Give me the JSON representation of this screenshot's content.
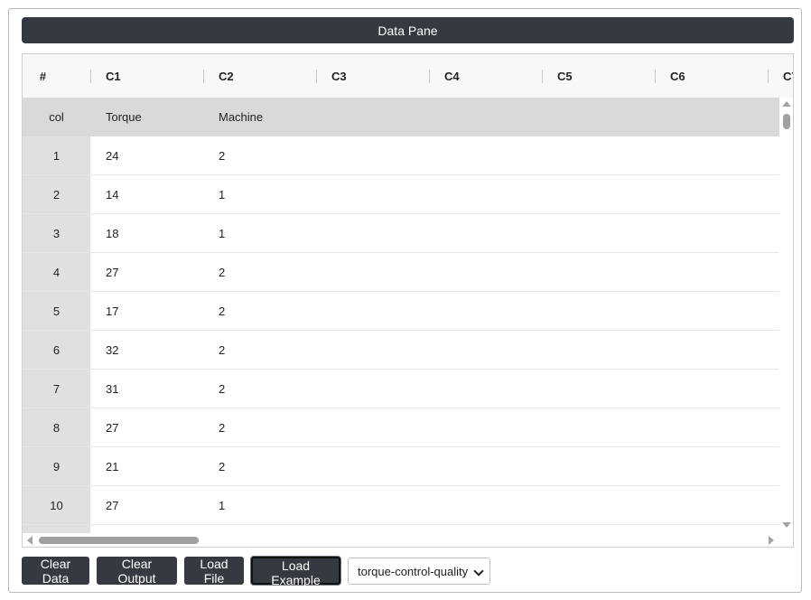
{
  "pane": {
    "title": "Data Pane"
  },
  "grid": {
    "columns": [
      "#",
      "C1",
      "C2",
      "C3",
      "C4",
      "C5",
      "C6",
      "C7"
    ],
    "header_row": {
      "label": "col",
      "values": [
        "Torque",
        "Machine"
      ]
    },
    "rows": [
      {
        "n": "1",
        "c1": "24",
        "c2": "2"
      },
      {
        "n": "2",
        "c1": "14",
        "c2": "1"
      },
      {
        "n": "3",
        "c1": "18",
        "c2": "1"
      },
      {
        "n": "4",
        "c1": "27",
        "c2": "2"
      },
      {
        "n": "5",
        "c1": "17",
        "c2": "2"
      },
      {
        "n": "6",
        "c1": "32",
        "c2": "2"
      },
      {
        "n": "7",
        "c1": "31",
        "c2": "2"
      },
      {
        "n": "8",
        "c1": "27",
        "c2": "2"
      },
      {
        "n": "9",
        "c1": "21",
        "c2": "2"
      },
      {
        "n": "10",
        "c1": "27",
        "c2": "1"
      }
    ]
  },
  "toolbar": {
    "clear_data": "Clear Data",
    "clear_output": "Clear Output",
    "load_file": "Load File",
    "load_example": "Load Example",
    "example_select": "torque-control-quality"
  },
  "colors": {
    "header_bg": "#343a40",
    "row_header_bg": "#e0e0e0",
    "label_row_bg": "#d9d9d9"
  }
}
